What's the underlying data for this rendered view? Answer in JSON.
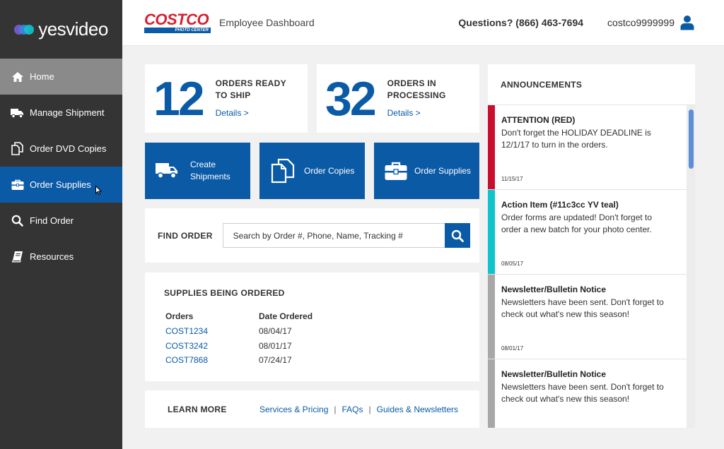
{
  "sidebar": {
    "logo_text": "yesvideo",
    "items": [
      {
        "label": "Home",
        "icon": "home-icon"
      },
      {
        "label": "Manage Shipment",
        "icon": "truck-icon"
      },
      {
        "label": "Order DVD Copies",
        "icon": "copies-icon"
      },
      {
        "label": "Order Supplies",
        "icon": "toolbox-icon"
      },
      {
        "label": "Find Order",
        "icon": "search-icon"
      },
      {
        "label": "Resources",
        "icon": "book-icon"
      }
    ],
    "active": "Order Supplies"
  },
  "header": {
    "brand_word": "COSTCO",
    "brand_sub": "PHOTO CENTER",
    "title": "Employee Dashboard",
    "questions": "Questions? (866) 463-7694",
    "username": "costco9999999"
  },
  "stats": [
    {
      "number": "12",
      "label_line1": "ORDERS READY",
      "label_line2": "TO SHIP",
      "link": "Details >"
    },
    {
      "number": "32",
      "label_line1": "ORDERS IN",
      "label_line2": "PROCESSING",
      "link": "Details >"
    }
  ],
  "actions": [
    {
      "line1": "Create",
      "line2": "Shipments",
      "icon": "truck-icon"
    },
    {
      "line1": "Order Copies",
      "line2": "",
      "icon": "copies-icon"
    },
    {
      "line1": "Order Supplies",
      "line2": "",
      "icon": "toolbox-icon"
    }
  ],
  "find_order": {
    "label": "FIND ORDER",
    "placeholder": "Search by Order #, Phone, Name, Tracking #"
  },
  "supplies": {
    "title": "SUPPLIES BEING ORDERED",
    "columns": [
      "Orders",
      "Date Ordered"
    ],
    "rows": [
      {
        "order": "COST1234",
        "date": "08/04/17"
      },
      {
        "order": "COST3242",
        "date": "08/01/17"
      },
      {
        "order": "COST7868",
        "date": "07/24/17"
      }
    ]
  },
  "learn_more": {
    "label": "LEARN MORE",
    "links": [
      "Services & Pricing",
      "FAQs",
      "Guides & Newsletters"
    ],
    "separator": "|"
  },
  "announcements": {
    "title": "ANNOUNCEMENTS",
    "items": [
      {
        "heading": "ATTENTION (RED)",
        "body": "Don't forget the HOLIDAY DEADLINE is 12/1/17 to turn in the orders.",
        "date": "11/15/17",
        "color": "#c8102e"
      },
      {
        "heading": "Action Item (#11c3cc YV teal)",
        "body": "Order forms are updated! Don't forget to order a new batch for your photo center.",
        "date": "08/05/17",
        "color": "#11c3cc"
      },
      {
        "heading": "Newsletter/Bulletin Notice",
        "body": "Newsletters have been sent. Don't forget to check out what's new this season!",
        "date": "08/01/17",
        "color": "#a8a8a8"
      },
      {
        "heading": "Newsletter/Bulletin Notice",
        "body": "Newsletters have been sent. Don't forget to check out what's new this season!",
        "date": "",
        "color": "#a8a8a8"
      }
    ]
  },
  "colors": {
    "accent": "#0a5aa6",
    "sidebar_bg": "#343434",
    "home_bg": "#8a8a8a",
    "brand_red": "#d71f30"
  }
}
